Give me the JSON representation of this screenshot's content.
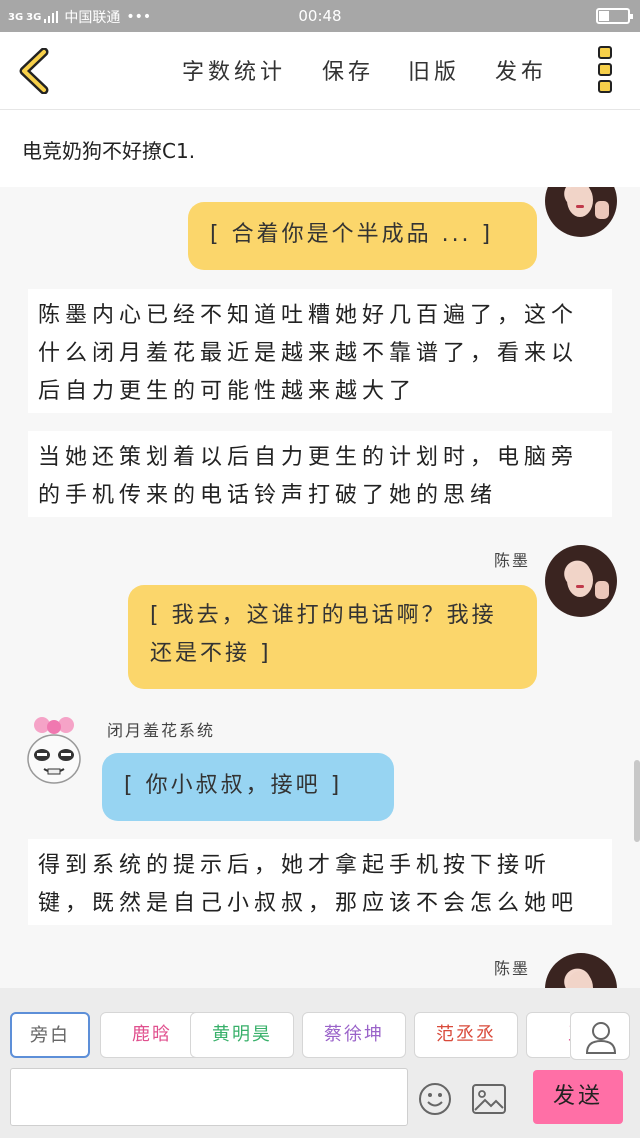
{
  "status_bar": {
    "network_1": "3G",
    "network_2": "3G",
    "carrier": "中国联通",
    "more": "•••",
    "time": "00:48",
    "battery_level": 0.35
  },
  "toolbar": {
    "back_icon": "chevron-left-icon",
    "word_count": "字数统计",
    "save": "保存",
    "old_version": "旧版",
    "publish": "发布",
    "menu_icon": "three-square-menu-icon"
  },
  "title": "电竞奶狗不好撩C1.",
  "messages": {
    "bubble_1": "[ 合着你是个半成品 ... ]",
    "narration_1": "陈墨内心已经不知道吐糟她好几百遍了，这个什么闭月羞花最近是越来越不靠谱了，看来以后自力更生的可能性越来越大了",
    "narration_2": "当她还策划着以后自力更生的计划时，电脑旁的手机传来的电话铃声打破了她的思绪",
    "name_chenmo_1": "陈墨",
    "bubble_2": "[ 我去，这谁打的电话啊？我接还是不接 ]",
    "name_system": "闭月羞花系统",
    "bubble_3": "[ 你小叔叔，接吧 ]",
    "narration_3": "得到系统的提示后，她才拿起手机按下接听键，既然是自己小叔叔，那应该不会怎么她吧",
    "name_chenmo_2": "陈墨"
  },
  "characters": [
    {
      "label": "旁白",
      "color": "#666666"
    },
    {
      "label": "鹿晗",
      "color": "#e0508e"
    },
    {
      "label": "黄明昊",
      "color": "#38b06a"
    },
    {
      "label": "蔡徐坤",
      "color": "#9a63c9"
    },
    {
      "label": "范丞丞",
      "color": "#d94a3a"
    },
    {
      "label": "王",
      "color": "#e0508e"
    }
  ],
  "composer": {
    "input_value": "",
    "send": "发送",
    "user_icon": "user-icon",
    "emoji_icon": "smiley-icon",
    "image_icon": "image-icon"
  }
}
